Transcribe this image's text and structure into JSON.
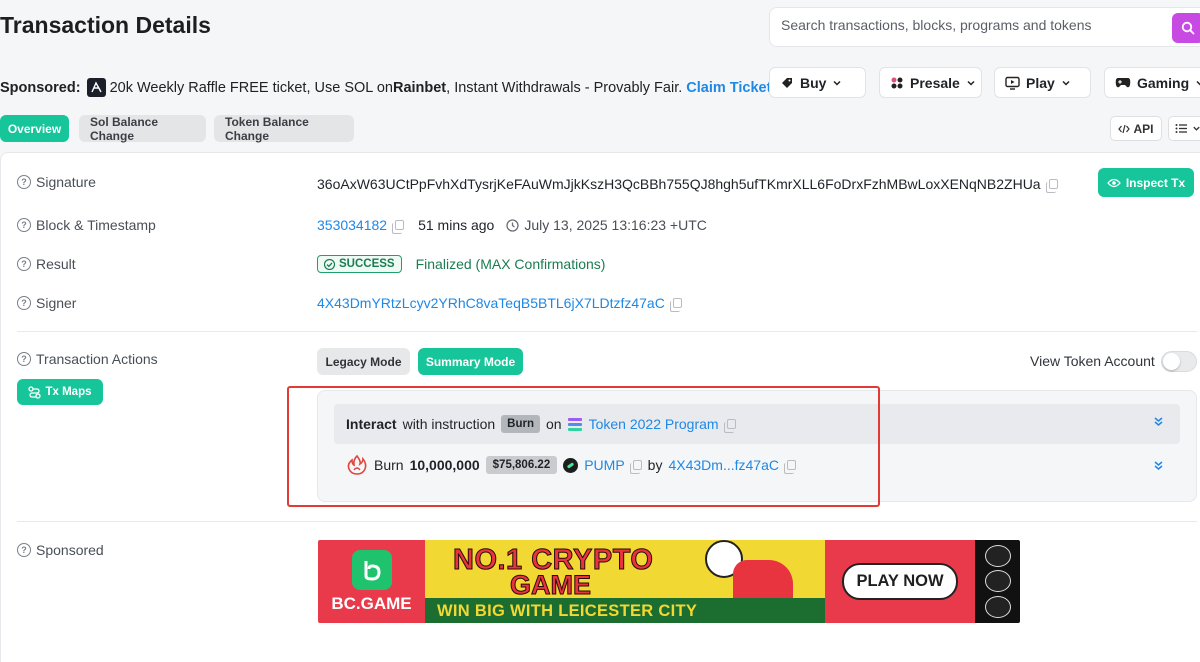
{
  "header": {
    "title": "Transaction Details",
    "search_placeholder": "Search transactions, blocks, programs and tokens"
  },
  "sponsor_line": {
    "label": "Sponsored:",
    "text_before": "20k Weekly Raffle FREE ticket, Use SOL on ",
    "brand": "Rainbet",
    "text_after": ", Instant Withdrawals - Provably Fair.",
    "cta": "Claim Ticket"
  },
  "top_menu": {
    "buy": "Buy",
    "presale": "Presale",
    "play": "Play",
    "gaming": "Gaming"
  },
  "tabs": {
    "overview": "Overview",
    "sol_balance": "Sol Balance Change",
    "token_balance": "Token Balance Change",
    "api": "API"
  },
  "details": {
    "signature_label": "Signature",
    "signature_value": "36oAxW63UCtPpFvhXdTysrjKeFAuWmJjkKszH3QcBBh755QJ8hgh5ufTKmrXLL6FoDrxFzhMBwLoxXENqNB2ZHUa",
    "inspect_btn": "Inspect Tx",
    "block_label": "Block & Timestamp",
    "block_value": "353034182",
    "block_age": "51 mins ago",
    "block_time": "July 13, 2025 13:16:23 +UTC",
    "result_label": "Result",
    "result_badge": "SUCCESS",
    "result_text": "Finalized (MAX Confirmations)",
    "signer_label": "Signer",
    "signer_value": "4X43DmYRtzLcyv2YRhC8vaTeqB5BTL6jX7LDtzfz47aC"
  },
  "actions": {
    "label": "Transaction Actions",
    "txmaps_btn": "Tx Maps",
    "legacy_mode": "Legacy Mode",
    "summary_mode": "Summary Mode",
    "view_token_account": "View Token Account",
    "instr_prefix": "Interact",
    "instr_with": "with instruction",
    "instr_name": "Burn",
    "instr_on": "on",
    "program_name": "Token 2022 Program",
    "burn_word": "Burn",
    "burn_amount": "10,000,000",
    "burn_usd": "$75,806.22",
    "token_name": "PUMP",
    "by_word": "by",
    "burner_short": "4X43Dm...fz47aC"
  },
  "sponsored": {
    "label": "Sponsored",
    "logo_text": "BC.GAME",
    "headline_1": "NO.1 CRYPTO",
    "headline_2": "GAME",
    "subline": "WIN BIG WITH LEICESTER CITY",
    "cta": "PLAY NOW"
  },
  "colors": {
    "accent_green": "#16c59a",
    "link_blue": "#1e88e5",
    "search_purple": "#c74ae3",
    "success_green": "#22a06b",
    "highlight_red": "#e23b35"
  }
}
